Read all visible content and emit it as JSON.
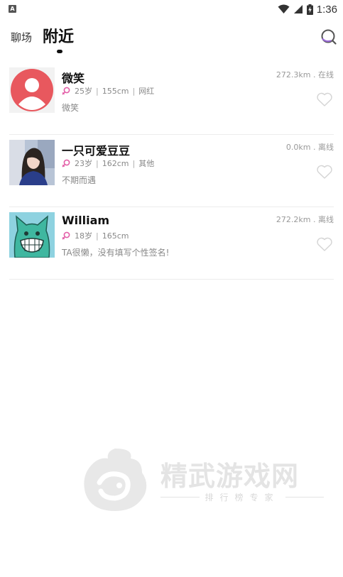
{
  "status_bar": {
    "time": "1:36",
    "notification_icon": "A"
  },
  "header": {
    "tabs": [
      {
        "label": "聊场",
        "active": false
      },
      {
        "label": "附近",
        "active": true
      }
    ],
    "search_icon": "search-icon"
  },
  "users": [
    {
      "name": "微笑",
      "distance": "272.3km . 在线",
      "age": "25岁",
      "height": "155cm",
      "tag": "网红",
      "signature": "微笑",
      "avatar": "default-person"
    },
    {
      "name": "一只可爱豆豆",
      "distance": "0.0km . 离线",
      "age": "23岁",
      "height": "162cm",
      "tag": "其他",
      "signature": "不期而遇",
      "avatar": "photo-girl"
    },
    {
      "name": " William",
      "distance": "272.2km . 离线",
      "age": "18岁",
      "height": "165cm",
      "tag": "",
      "signature": "TA很懒，没有填写个性签名!",
      "avatar": "cartoon-cat"
    }
  ],
  "watermark": {
    "title": "精武游戏网",
    "subtitle": "排行榜专家"
  },
  "colors": {
    "accent": "#9a6ad6",
    "gender_female": "#e35fa8",
    "avatar_red": "#e8585e"
  }
}
